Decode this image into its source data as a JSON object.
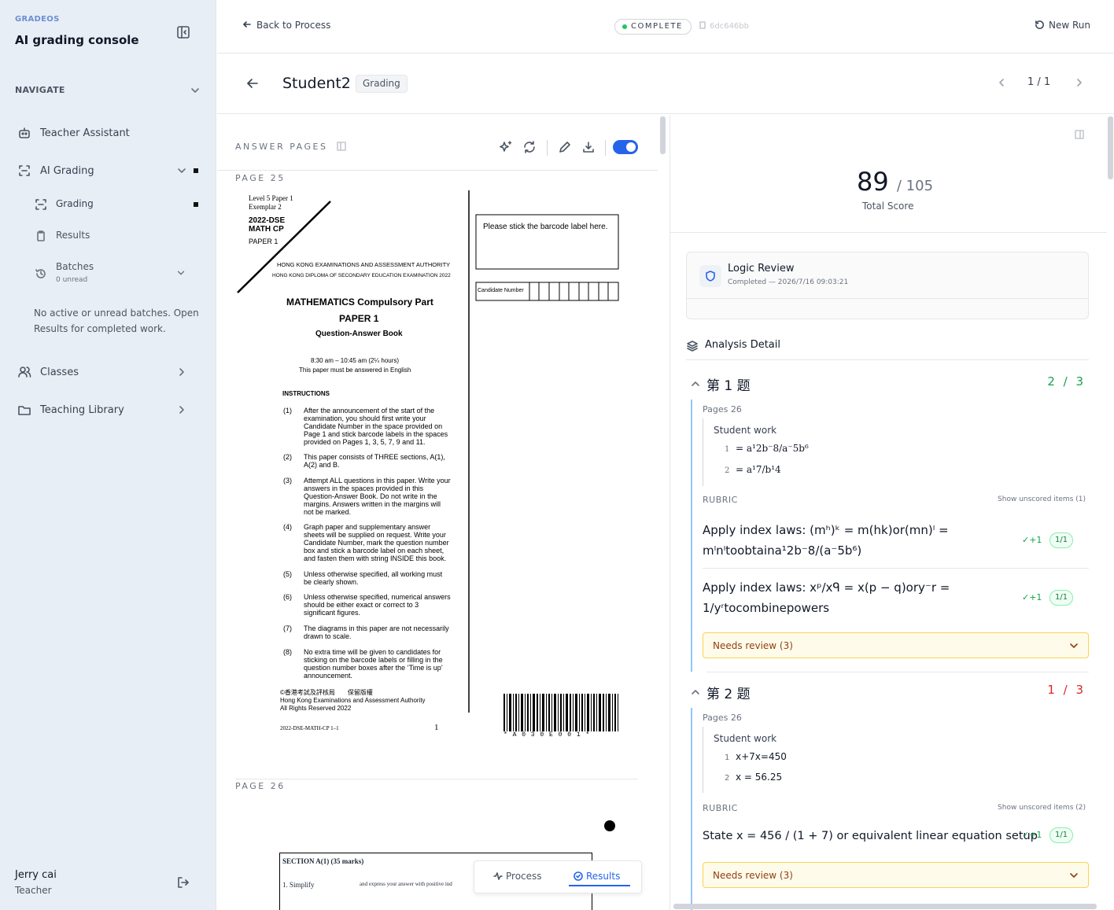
{
  "sidebar": {
    "brand": "GRADEOS",
    "title": "AI grading console",
    "nav_heading": "NAVIGATE",
    "items": [
      {
        "label": "Teacher Assistant"
      },
      {
        "label": "AI Grading"
      },
      {
        "label": "Grading"
      },
      {
        "label": "Results"
      },
      {
        "label": "Batches",
        "sub": "0 unread"
      },
      {
        "label": "Classes"
      },
      {
        "label": "Teaching Library"
      }
    ],
    "batch_note": "No active or unread batches. Open Results for completed work.",
    "user_name": "Jerry cai",
    "user_role": "Teacher"
  },
  "topbar": {
    "back_label": "Back to Process",
    "status": "COMPLETE",
    "run_id": "6dc646bb",
    "new_run": "New Run"
  },
  "header": {
    "student": "Student2",
    "badge": "Grading",
    "pager": "1 / 1"
  },
  "answer_pages": {
    "heading": "ANSWER PAGES",
    "page_labels": [
      "PAGE 25",
      "PAGE 26"
    ]
  },
  "exam": {
    "corner1": "Level 5 Paper 1",
    "corner2": "Exemplar 2",
    "code1": "2022-DSE",
    "code2": "MATH CP",
    "code3": "PAPER 1",
    "barcode_box": "Please stick the barcode label here.",
    "candidate": "Candidate Number",
    "authority1": "HONG KONG EXAMINATIONS AND ASSESSMENT AUTHORITY",
    "authority2": "HONG KONG DIPLOMA OF SECONDARY EDUCATION EXAMINATION 2022",
    "subject": "MATHEMATICS  Compulsory Part",
    "paper": "PAPER 1",
    "book": "Question-Answer Book",
    "time": "8:30 am – 10:45 am  (2¼ hours)",
    "english": "This paper must be answered in English",
    "instructions": "INSTRUCTIONS",
    "instr": [
      {
        "n": "(1)",
        "t": "After the announcement of the start of the examination, you should first write your Candidate Number in the space provided on Page 1 and stick barcode labels in the spaces provided on Pages 1, 3, 5, 7, 9 and 11."
      },
      {
        "n": "(2)",
        "t": "This paper consists of THREE sections, A(1), A(2) and B."
      },
      {
        "n": "(3)",
        "t": "Attempt ALL questions in this paper. Write your answers in the spaces provided in this Question-Answer Book. Do not write in the margins. Answers written in the margins will not be marked."
      },
      {
        "n": "(4)",
        "t": "Graph paper and supplementary answer sheets will be supplied on request. Write your Candidate Number, mark the question number box and stick a barcode label on each sheet, and fasten them with string INSIDE this book."
      },
      {
        "n": "(5)",
        "t": "Unless otherwise specified, all working must be clearly shown."
      },
      {
        "n": "(6)",
        "t": "Unless otherwise specified, numerical answers should be either exact or correct to 3 significant figures."
      },
      {
        "n": "(7)",
        "t": "The diagrams in this paper are not necessarily drawn to scale."
      },
      {
        "n": "(8)",
        "t": "No extra time will be given to candidates for sticking on the barcode labels or filling in the question number boxes after the ‘Time is up’ announcement."
      }
    ],
    "copyright1": "©香港考試及評核局　　保留版權",
    "copyright2": "Hong Kong Examinations and Assessment Authority",
    "copyright3": "All Rights Reserved 2022",
    "footer_code": "2022-DSE-MATH-CP 1–1",
    "page_num": "1",
    "barcode_text": "* A 0 3 0 E 0 0 1 *",
    "p26_section": "SECTION A(1)  (35 marks)",
    "p26_q1": "1.     Simplify",
    "p26_q1b": "and express your answer with positive ind"
  },
  "floatbar": {
    "process": "Process",
    "results": "Results"
  },
  "results": {
    "score": "89",
    "total": "/ 105",
    "score_label": "Total Score",
    "logic_title": "Logic Review",
    "logic_sub": "Completed — 2026/7/16 09:03:21",
    "analysis_heading": "Analysis Detail",
    "questions": [
      {
        "title": "第 1 题",
        "score": "2 / 3",
        "pages": "Pages 26",
        "student_work_label": "Student work",
        "work": [
          {
            "n": "1",
            "t": "= a¹2b⁻8/a⁻5b⁶"
          },
          {
            "n": "2",
            "t": "= a¹7/b¹4"
          }
        ],
        "rubric_label": "RUBRIC",
        "unscored": "Show unscored items (1)",
        "rubric": [
          {
            "text": "Apply index laws: (mʰ)ᵏ = m(hk)or(mn)ˡ = mˡnˡtoobtaina¹2b⁻8/(a⁻5b⁶)",
            "mark": "✓+1",
            "pill": "1/1"
          },
          {
            "text": "Apply index laws: xᵖ/xᑫ = x(p − q)ory⁻r = 1/yʳtocombinepowers",
            "mark": "✓+1",
            "pill": "1/1"
          }
        ],
        "review": "Needs review (3)"
      },
      {
        "title": "第 2 题",
        "score": "1 / 3",
        "pages": "Pages 26",
        "student_work_label": "Student work",
        "work": [
          {
            "n": "1",
            "t": "x+7x=450"
          },
          {
            "n": "2",
            "t": "x = 56.25"
          }
        ],
        "rubric_label": "RUBRIC",
        "unscored": "Show unscored items (2)",
        "rubric": [
          {
            "text": "State x = 456 / (1 + 7) or equivalent linear equation setup",
            "mark": "✓+1",
            "pill": "1/1"
          }
        ],
        "review": "Needs review (3)"
      }
    ]
  },
  "colors": {
    "accent": "#2563eb",
    "good": "#16a34a",
    "bad": "#dc2626",
    "warning_bg": "#fffbeb"
  }
}
